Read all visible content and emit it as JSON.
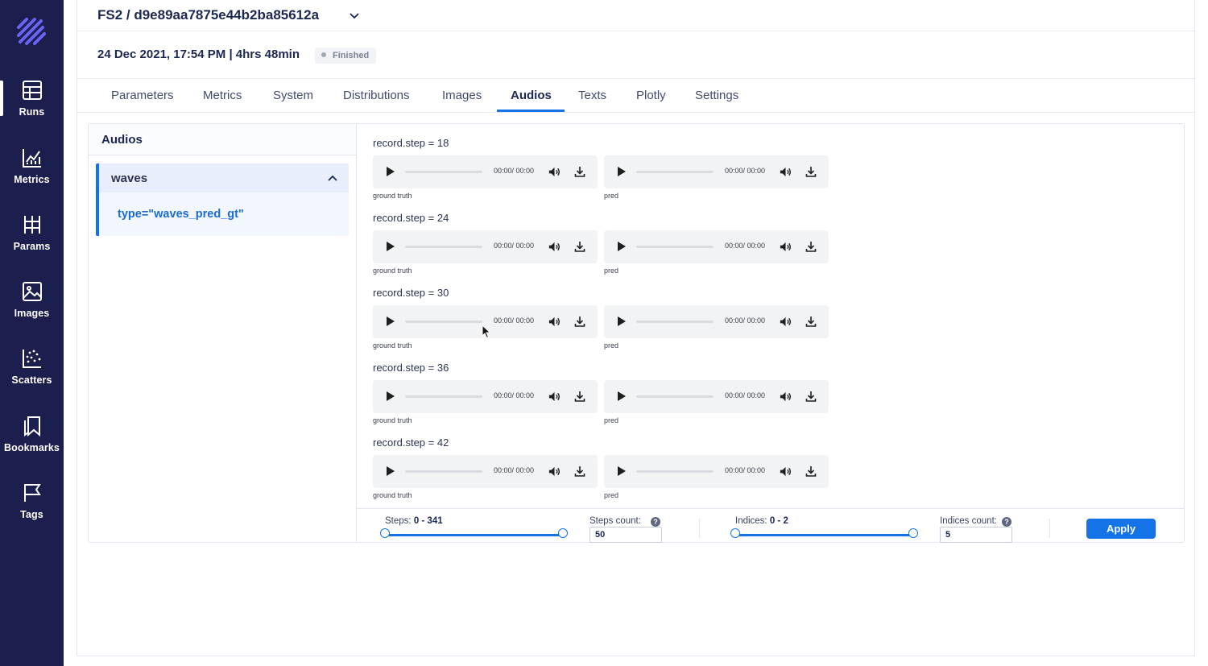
{
  "sidebar": {
    "logo_icon": "aim-logo-icon",
    "items": [
      {
        "label": "Runs",
        "icon": "table-icon",
        "active": true
      },
      {
        "label": "Metrics",
        "icon": "chart-icon"
      },
      {
        "label": "Params",
        "icon": "params-icon"
      },
      {
        "label": "Images",
        "icon": "image-icon"
      },
      {
        "label": "Scatters",
        "icon": "scatter-icon"
      },
      {
        "label": "Bookmarks",
        "icon": "bookmark-icon"
      },
      {
        "label": "Tags",
        "icon": "flag-icon"
      }
    ]
  },
  "header": {
    "run_title": "FS2 / d9e89aa7875e44b2ba85612a",
    "date": "24 Dec 2021, 17:54 PM | 4hrs 48min",
    "status": "Finished"
  },
  "tabs": [
    {
      "label": "Parameters"
    },
    {
      "label": "Metrics"
    },
    {
      "label": "System"
    },
    {
      "label": "Distributions"
    },
    {
      "label": "Images"
    },
    {
      "label": "Audios",
      "active": true
    },
    {
      "label": "Texts"
    },
    {
      "label": "Plotly"
    },
    {
      "label": "Settings"
    }
  ],
  "audios_panel": {
    "title": "Audios",
    "group": {
      "name": "waves",
      "item": "type=\"waves_pred_gt\""
    }
  },
  "records": [
    {
      "title": "record.step = 18",
      "players": [
        {
          "time": "00:00/ 00:00",
          "caption": "ground truth"
        },
        {
          "time": "00:00/ 00:00",
          "caption": "pred"
        }
      ]
    },
    {
      "title": "record.step = 24",
      "players": [
        {
          "time": "00:00/ 00:00",
          "caption": "ground truth"
        },
        {
          "time": "00:00/ 00:00",
          "caption": "pred"
        }
      ]
    },
    {
      "title": "record.step = 30",
      "players": [
        {
          "time": "00:00/ 00:00",
          "caption": "ground truth"
        },
        {
          "time": "00:00/ 00:00",
          "caption": "pred"
        }
      ]
    },
    {
      "title": "record.step = 36",
      "players": [
        {
          "time": "00:00/ 00:00",
          "caption": "ground truth"
        },
        {
          "time": "00:00/ 00:00",
          "caption": "pred"
        }
      ]
    },
    {
      "title": "record.step = 42",
      "players": [
        {
          "time": "00:00/ 00:00",
          "caption": "ground truth"
        },
        {
          "time": "00:00/ 00:00",
          "caption": "pred"
        }
      ]
    }
  ],
  "controls": {
    "steps_label": "Steps:",
    "steps_range": "0 - 341",
    "steps_count_label": "Steps count:",
    "steps_count_value": "50",
    "indices_label": "Indices:",
    "indices_range": "0 - 2",
    "indices_count_label": "Indices count:",
    "indices_count_value": "5",
    "help_glyph": "?",
    "apply_label": "Apply"
  },
  "colors": {
    "sidebar_bg": "#1c1f4d",
    "accent": "#1473e6",
    "text_dark": "#1c2852"
  }
}
